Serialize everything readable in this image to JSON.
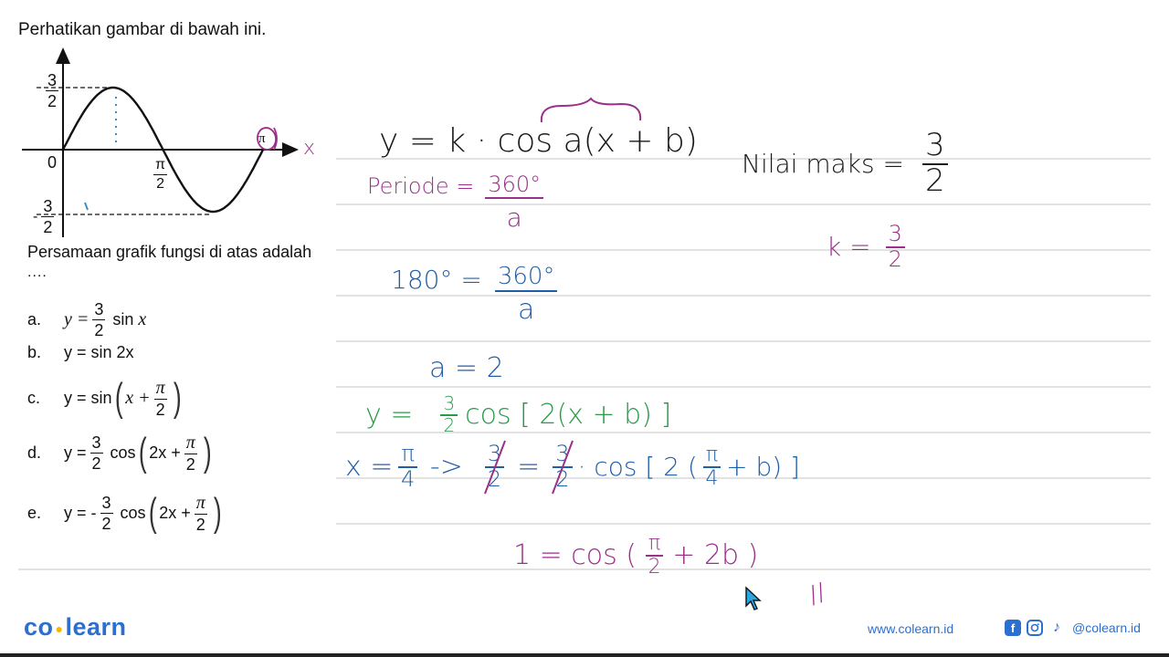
{
  "question": {
    "title": "Perhatikan gambar di bawah ini.",
    "prompt": "Persamaan grafik fungsi di atas adalah",
    "ellipsis": "....",
    "options": [
      {
        "letter": "a.",
        "lhs": "y =",
        "coef_num": "3",
        "coef_den": "2",
        "func": "sin",
        "arg": "x"
      },
      {
        "letter": "b.",
        "lhs": "y = sin 2x"
      },
      {
        "letter": "c.",
        "lhs": "y = sin",
        "arg_pre": "x +",
        "arg_num": "π",
        "arg_den": "2"
      },
      {
        "letter": "d.",
        "lhs": "y =",
        "coef_num": "3",
        "coef_den": "2",
        "func": "cos",
        "arg_pre": "2x +",
        "arg_num": "π",
        "arg_den": "2"
      },
      {
        "letter": "e.",
        "lhs": "y = -",
        "coef_num": "3",
        "coef_den": "2",
        "func": "cos",
        "arg_pre": "2x +",
        "arg_num": "π",
        "arg_den": "2"
      }
    ]
  },
  "graph": {
    "y_max_label_num": "3",
    "y_max_label_den": "2",
    "y_min_label_prefix": "-",
    "y_min_label_num": "3",
    "y_min_label_den": "2",
    "origin_label": "0",
    "half_pi_num": "π",
    "half_pi_den": "2",
    "pi_label": "π",
    "x_axis_label": "x",
    "amplitude": 1.5,
    "x_range": [
      "0",
      "π"
    ],
    "function": "y = 3/2 sin(2x)"
  },
  "handwriting": {
    "general_form": "y = k · cos a(x + b)",
    "nilai_maks_label": "Nilai maks =",
    "nilai_maks_num": "3",
    "nilai_maks_den": "2",
    "k_label": "k =",
    "k_num": "3",
    "k_den": "2",
    "periode_label": "Periode =",
    "periode_num": "360°",
    "periode_den": "a",
    "eq180_lhs": "180° =",
    "eq180_num": "360°",
    "eq180_den": "a",
    "a_result": "a = 2",
    "subst_lhs": "y =",
    "subst_num": "3",
    "subst_den": "2",
    "subst_rhs": "cos [ 2(x + b) ]",
    "x_val_lhs": "x =",
    "x_val_num": "π",
    "x_val_den": "4",
    "arrow": "->",
    "eq_l_num": "3",
    "eq_l_den": "2",
    "eq_mid": "=",
    "eq_r_num": "3",
    "eq_r_den": "2",
    "eq_r_tail_pre": "· cos [ 2 (",
    "eq_r_frac_num": "π",
    "eq_r_frac_den": "4",
    "eq_r_tail_post": "+ b) ]",
    "final_lhs": "1 = cos (",
    "final_num": "π",
    "final_den": "2",
    "final_rhs": "+ 2b )",
    "final_mark": "//"
  },
  "colors": {
    "ink_black": "#1a1a1a",
    "ink_magenta": "#9b2f8a",
    "ink_blue": "#1f5fa8",
    "ink_green": "#2a9a4a",
    "brand_blue": "#2b6fd1",
    "brand_dot": "#f4b400"
  },
  "footer": {
    "logo_left": "co",
    "logo_right": "learn",
    "website": "www.colearn.id",
    "handle": "@colearn.id",
    "icons": [
      "facebook-icon",
      "instagram-icon",
      "tiktok-icon"
    ]
  }
}
